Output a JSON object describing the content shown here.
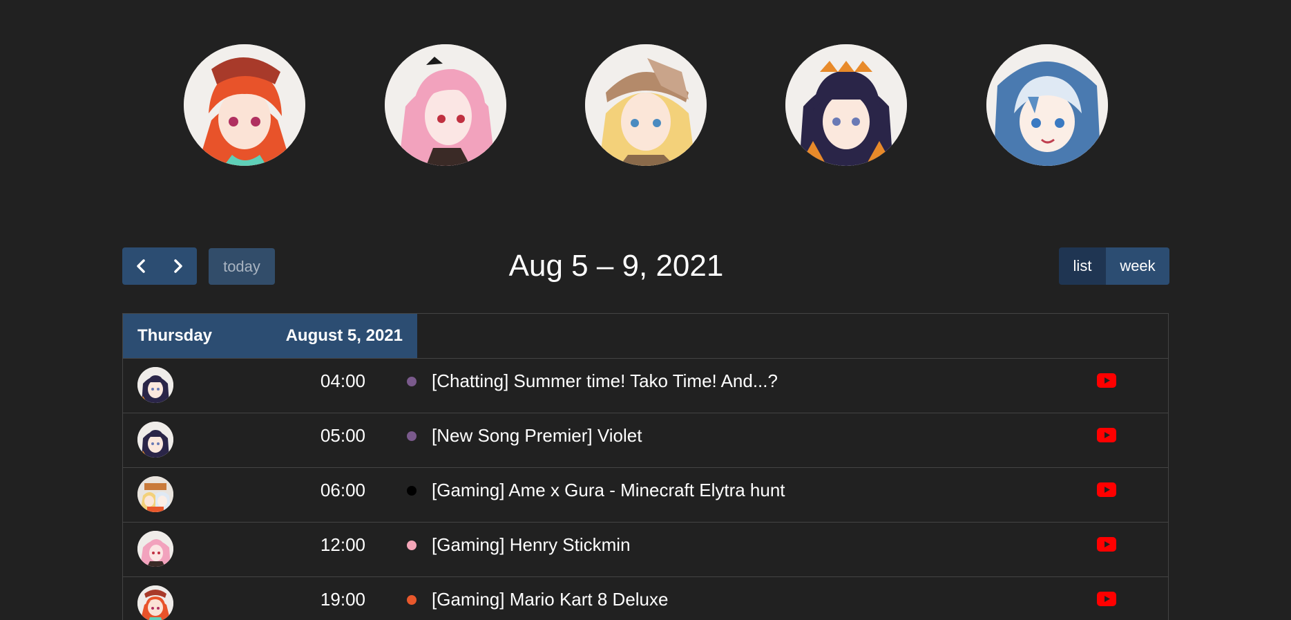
{
  "talents": [
    {
      "name": "talent-avatar-1",
      "hair": "#e8532a",
      "hair_dark": "#b73a18",
      "eyes": "#b03060",
      "accent": "#a83a2a"
    },
    {
      "name": "talent-avatar-2",
      "hair": "#f2a2bd",
      "hair_dark": "#d77b9b",
      "eyes": "#c03040",
      "accent": "#1a1a1a"
    },
    {
      "name": "talent-avatar-3",
      "hair": "#f3d17a",
      "hair_dark": "#d7a64a",
      "eyes": "#4a8bc0",
      "accent": "#b48a6a"
    },
    {
      "name": "talent-avatar-4",
      "hair": "#2a2548",
      "hair_dark": "#15122a",
      "eyes": "#6a7ab5",
      "accent": "#e88a2a"
    },
    {
      "name": "talent-avatar-5",
      "hair": "#dfe9f4",
      "hair_dark": "#5a8ec4",
      "eyes": "#3a7ac2",
      "accent": "#4a7ab0"
    }
  ],
  "toolbar": {
    "prev_icon": "chevron-left-icon",
    "next_icon": "chevron-right-icon",
    "today_label": "today",
    "range_title": "Aug 5 – 9, 2021",
    "view_list_label": "list",
    "view_week_label": "week"
  },
  "day": {
    "name": "Thursday",
    "date": "August 5, 2021"
  },
  "events": [
    {
      "time": "04:00",
      "title": "[Chatting] Summer time! Tako Time! And...?",
      "dot_color": "#7a5a8c",
      "avatar": "ina"
    },
    {
      "time": "05:00",
      "title": "[New Song Premier] Violet",
      "dot_color": "#7a5a8c",
      "avatar": "ina"
    },
    {
      "time": "06:00",
      "title": "[Gaming] Ame x Gura - Minecraft Elytra hunt",
      "dot_color": "#000000",
      "avatar": "collab"
    },
    {
      "time": "12:00",
      "title": "[Gaming] Henry Stickmin",
      "dot_color": "#f4a6b8",
      "avatar": "calli"
    },
    {
      "time": "19:00",
      "title": "[Gaming] Mario Kart 8 Deluxe",
      "dot_color": "#e8582c",
      "avatar": "kiara"
    }
  ],
  "colors": {
    "background": "#212121",
    "button_primary": "#2c4d72",
    "button_active": "#1f3552",
    "youtube_red": "#ff0000"
  },
  "platform_icon": "youtube-icon"
}
